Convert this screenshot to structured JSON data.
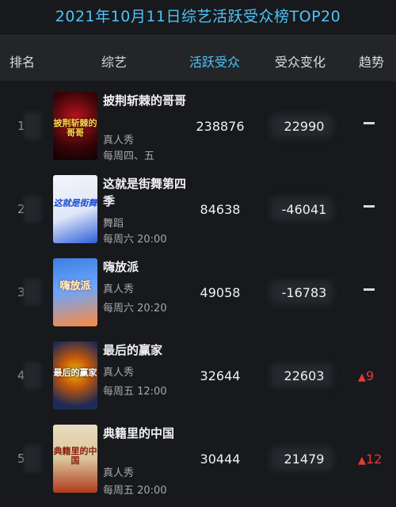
{
  "title": "2021年10月11日综艺活跃受众榜TOP20",
  "header": {
    "rank": "排名",
    "show": "综艺",
    "active": "活跃受众",
    "change": "受众变化",
    "trend": "趋势"
  },
  "rows": [
    {
      "rank": "1",
      "name": "披荆斩棘的哥哥",
      "genre": "真人秀",
      "schedule": "每周四、五",
      "active": "238876",
      "change": "22990",
      "trend": "",
      "trend_type": "flat",
      "poster_text": "披荆斩棘的哥哥",
      "poster_colors": [
        "#3a0508",
        "#c2141c"
      ]
    },
    {
      "rank": "2",
      "name": "这就是街舞第四季",
      "genre": "舞蹈",
      "schedule": "每周六 20:00",
      "active": "84638",
      "change": "-46041",
      "trend": "",
      "trend_type": "flat",
      "poster_text": "这就是街舞",
      "poster_colors": [
        "#f4f6fb",
        "#2b5fd9"
      ]
    },
    {
      "rank": "3",
      "name": "嗨放派",
      "genre": "真人秀",
      "schedule": "每周六 20:20",
      "active": "49058",
      "change": "-16783",
      "trend": "",
      "trend_type": "flat",
      "poster_text": "嗨放派",
      "poster_colors": [
        "#3d7fe0",
        "#ff8a3d"
      ]
    },
    {
      "rank": "4",
      "name": "最后的赢家",
      "genre": "真人秀",
      "schedule": "每周五 12:00",
      "active": "32644",
      "change": "22603",
      "trend": "9",
      "trend_type": "up",
      "poster_text": "最后的赢家",
      "poster_colors": [
        "#1d2a55",
        "#f2b705"
      ]
    },
    {
      "rank": "5",
      "name": "典籍里的中国",
      "genre": "真人秀",
      "schedule": "每周五 20:00",
      "active": "30444",
      "change": "21479",
      "trend": "12",
      "trend_type": "up",
      "poster_text": "典籍里的中国",
      "poster_colors": [
        "#e9dcc0",
        "#b23a1c"
      ]
    }
  ],
  "colors": {
    "accent": "#4fc3f7",
    "up": "#e53935",
    "background": "#17191d"
  }
}
